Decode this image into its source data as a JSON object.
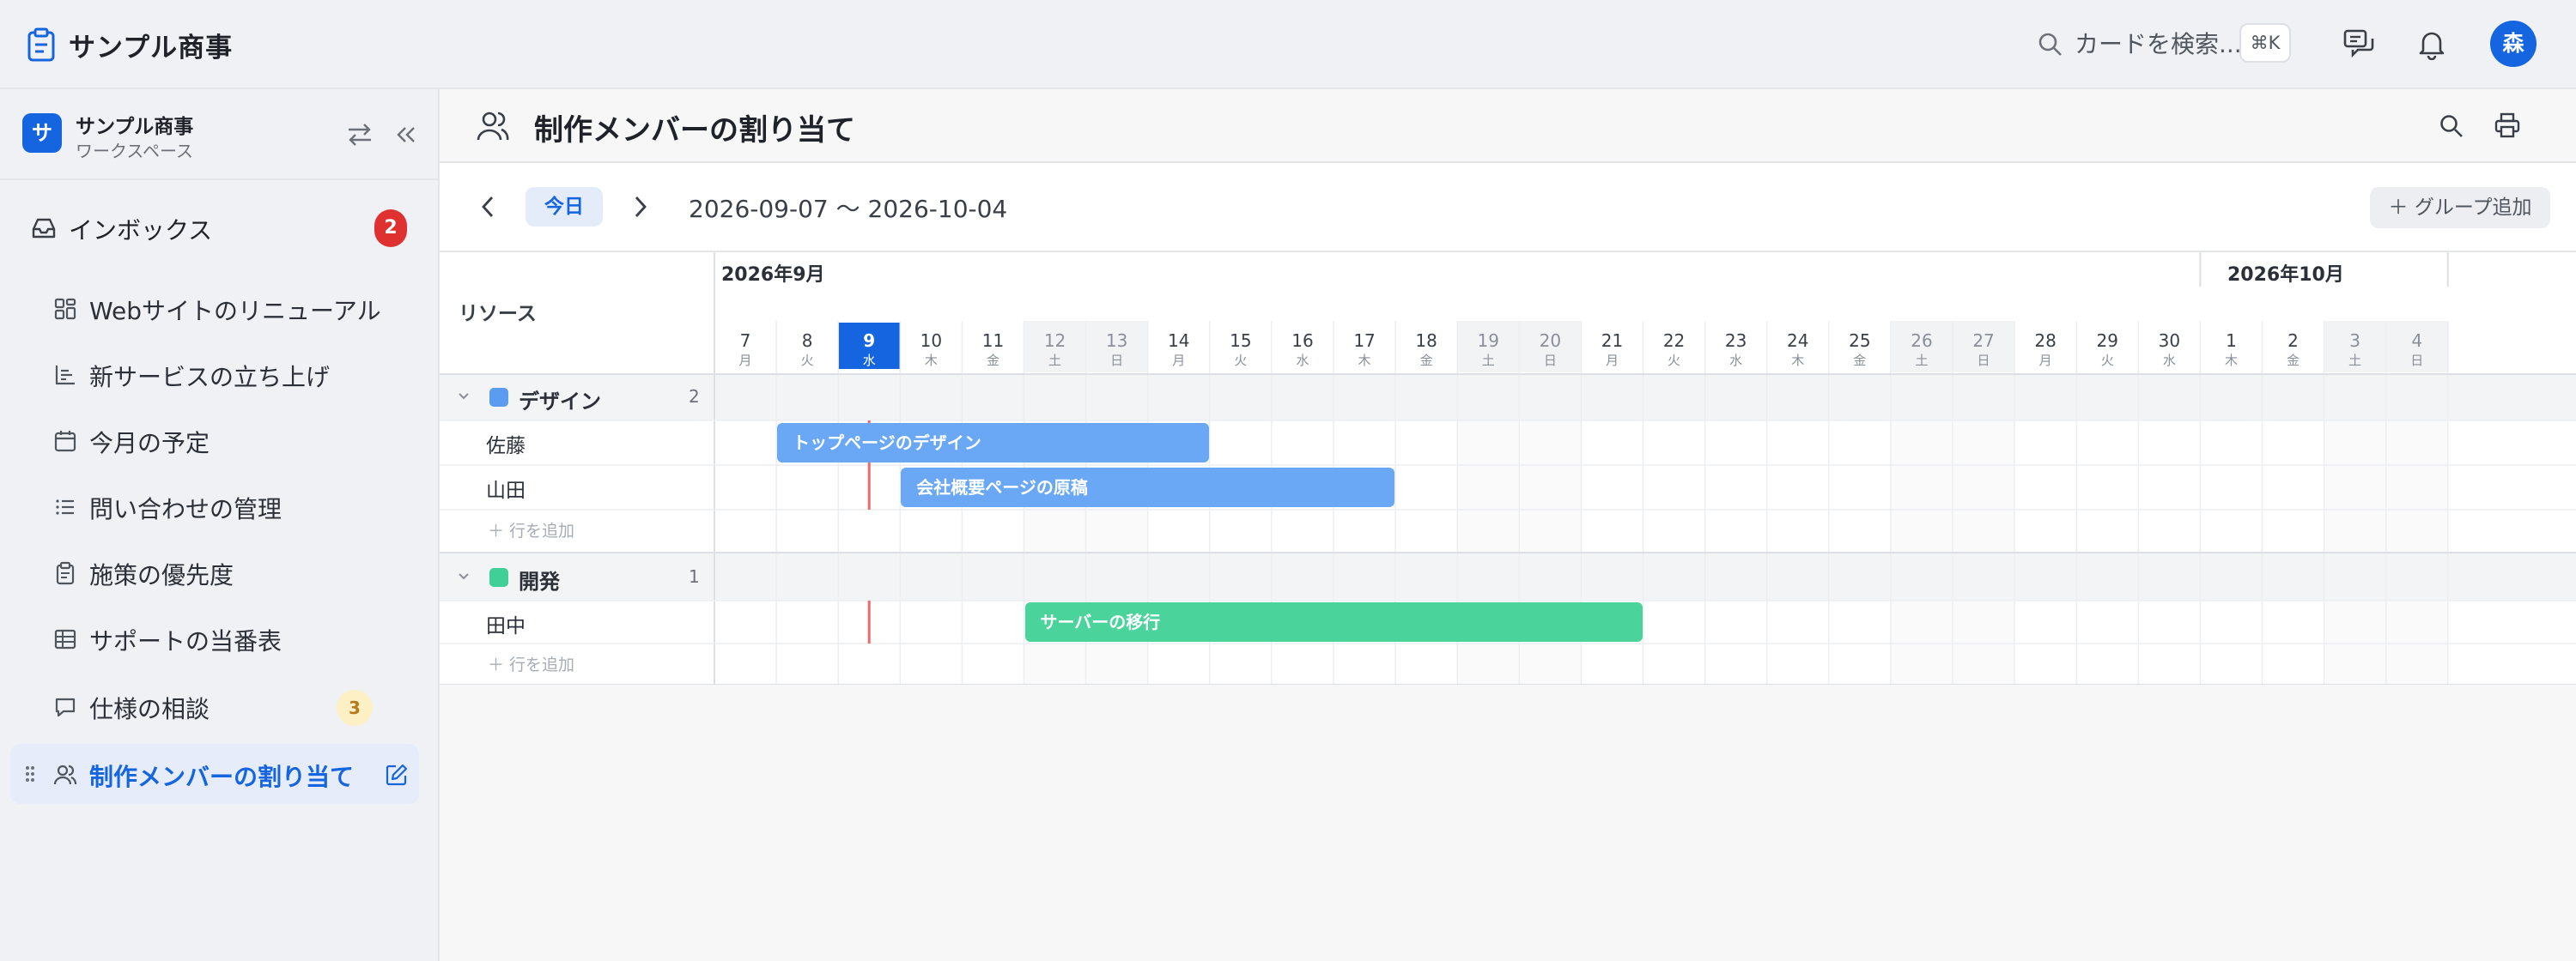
{
  "app": {
    "title": "サンプル商事"
  },
  "topbar": {
    "search_placeholder": "カードを検索...",
    "shortcut": "⌘K",
    "avatar_initial": "森"
  },
  "workspace": {
    "badge": "サ",
    "name": "サンプル商事",
    "label": "ワークスペース"
  },
  "inbox": {
    "label": "インボックス",
    "count": "2"
  },
  "nav": [
    {
      "label": "Webサイトのリニューアル",
      "icon": "board-icon"
    },
    {
      "label": "新サービスの立ち上げ",
      "icon": "chart-icon"
    },
    {
      "label": "今月の予定",
      "icon": "calendar-icon"
    },
    {
      "label": "問い合わせの管理",
      "icon": "list-icon"
    },
    {
      "label": "施策の優先度",
      "icon": "clipboard-icon"
    },
    {
      "label": "サポートの当番表",
      "icon": "table-icon"
    },
    {
      "label": "仕様の相談",
      "icon": "chat-icon",
      "count": "3"
    },
    {
      "label": "制作メンバーの割り当て",
      "icon": "users-icon",
      "active": true
    }
  ],
  "page": {
    "title": "制作メンバーの割り当て"
  },
  "toolbar": {
    "today": "今日",
    "range": "2026-09-07 〜 2026-10-04",
    "add_group": "＋ グループ追加"
  },
  "timeline": {
    "resource_header": "リソース",
    "months": [
      "2026年9月",
      "2026年10月"
    ],
    "today_index": 2,
    "days": [
      {
        "d": "7",
        "w": "月"
      },
      {
        "d": "8",
        "w": "火"
      },
      {
        "d": "9",
        "w": "水"
      },
      {
        "d": "10",
        "w": "木"
      },
      {
        "d": "11",
        "w": "金"
      },
      {
        "d": "12",
        "w": "土"
      },
      {
        "d": "13",
        "w": "日"
      },
      {
        "d": "14",
        "w": "月"
      },
      {
        "d": "15",
        "w": "火"
      },
      {
        "d": "16",
        "w": "水"
      },
      {
        "d": "17",
        "w": "木"
      },
      {
        "d": "18",
        "w": "金"
      },
      {
        "d": "19",
        "w": "土"
      },
      {
        "d": "20",
        "w": "日"
      },
      {
        "d": "21",
        "w": "月"
      },
      {
        "d": "22",
        "w": "火"
      },
      {
        "d": "23",
        "w": "水"
      },
      {
        "d": "24",
        "w": "木"
      },
      {
        "d": "25",
        "w": "金"
      },
      {
        "d": "26",
        "w": "土"
      },
      {
        "d": "27",
        "w": "日"
      },
      {
        "d": "28",
        "w": "月"
      },
      {
        "d": "29",
        "w": "火"
      },
      {
        "d": "30",
        "w": "水"
      },
      {
        "d": "1",
        "w": "木"
      },
      {
        "d": "2",
        "w": "金"
      },
      {
        "d": "3",
        "w": "土"
      },
      {
        "d": "4",
        "w": "日"
      }
    ],
    "groups": [
      {
        "name": "デザイン",
        "count": "2",
        "color": "#5b9cf0",
        "members": [
          "佐藤",
          "山田"
        ],
        "add_row": "＋ 行を追加"
      },
      {
        "name": "開発",
        "count": "1",
        "color": "#3fcf97",
        "members": [
          "田中"
        ],
        "add_row": "＋ 行を追加"
      }
    ],
    "tasks": [
      {
        "label": "トップページのデザイン",
        "group": 0,
        "member": 0,
        "start": "2026-09-08",
        "end": "2026-09-14",
        "color": "#6aa8f5"
      },
      {
        "label": "会社概要ページの原稿",
        "group": 0,
        "member": 1,
        "start": "2026-09-10",
        "end": "2026-09-17",
        "color": "#6aa8f5"
      },
      {
        "label": "サーバーの移行",
        "group": 1,
        "member": 0,
        "start": "2026-09-12",
        "end": "2026-09-21",
        "color": "#4ad49c"
      }
    ]
  }
}
